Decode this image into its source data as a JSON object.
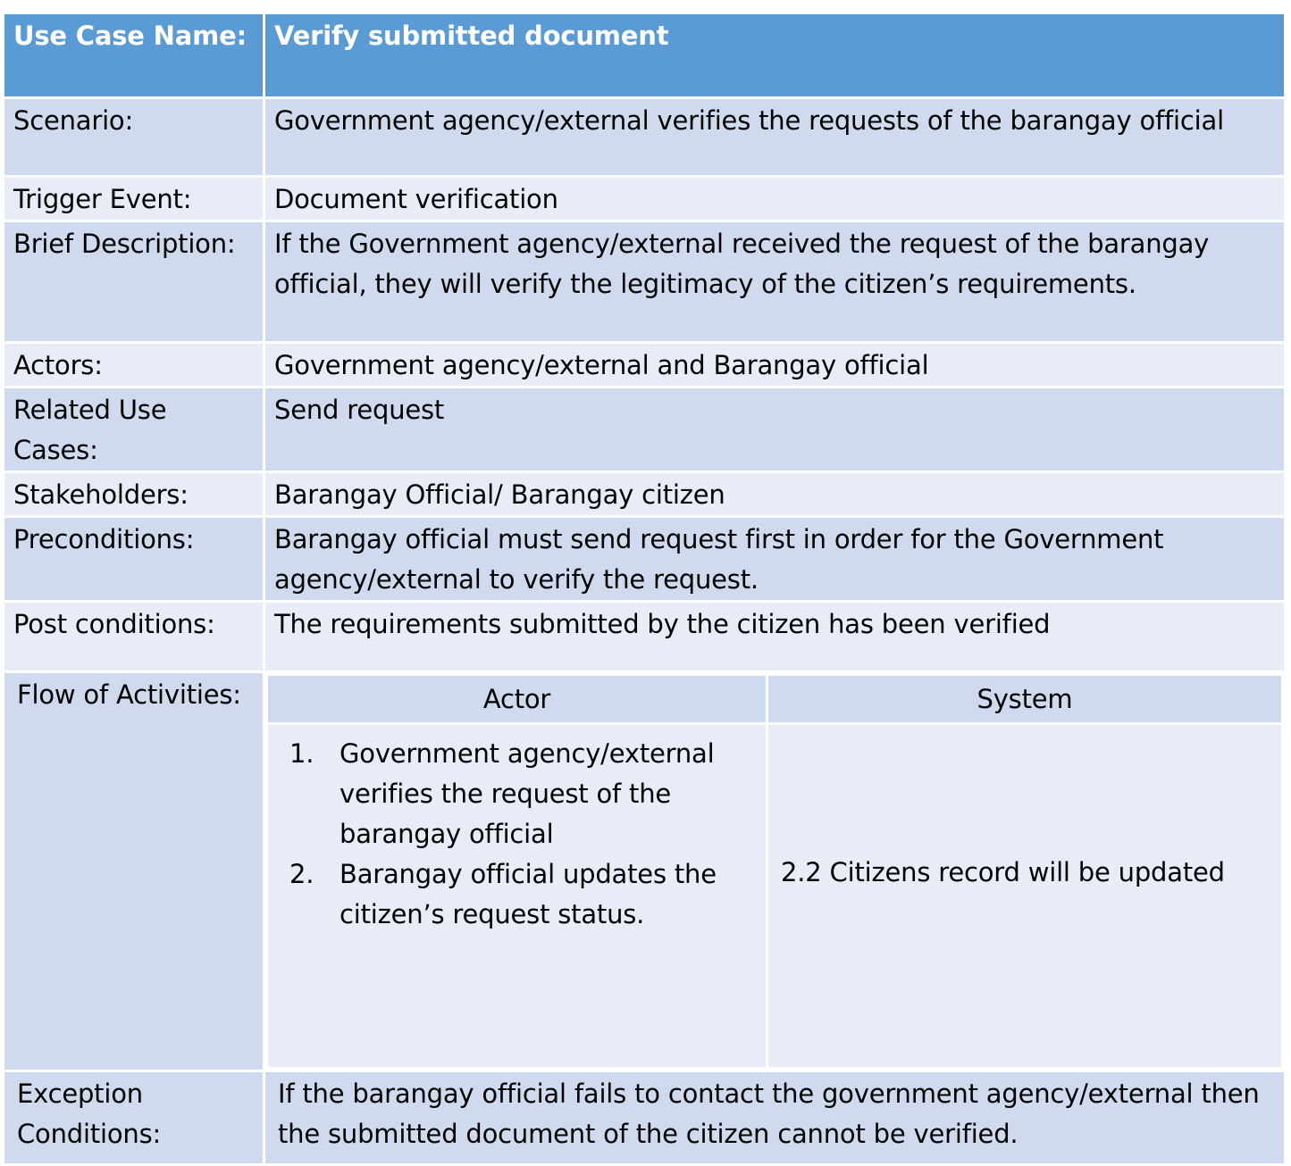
{
  "use_case": {
    "name_label": "Use Case Name:",
    "name_value": "Verify submitted document",
    "rows": [
      {
        "label": "Scenario:",
        "value": "Government agency/external verifies the requests of the barangay official"
      },
      {
        "label": "Trigger Event:",
        "value": "Document verification"
      },
      {
        "label": "Brief Description:",
        "value": "If the Government agency/external received the request of the barangay official, they will verify the legitimacy of the citizen’s requirements."
      },
      {
        "label": "Actors:",
        "value": "Government agency/external and Barangay official"
      },
      {
        "label": "Related Use Cases:",
        "value": "Send request"
      },
      {
        "label": "Stakeholders:",
        "value": "Barangay Official/ Barangay citizen"
      },
      {
        "label": "Preconditions:",
        "value": "Barangay official must send request first in order for the Government agency/external to verify the request."
      },
      {
        "label": "Post conditions:",
        "value": "The requirements submitted by the citizen has been verified"
      }
    ],
    "flow": {
      "label": "Flow of Activities:",
      "actor_header": "Actor",
      "system_header": "System",
      "actor_steps": [
        {
          "num": "1.",
          "text": "Government agency/external verifies  the request of the barangay official"
        },
        {
          "num": "2.",
          "text": "Barangay official updates the citizen’s request status."
        }
      ],
      "system_text": "2.2 Citizens record will be updated"
    },
    "exception": {
      "label": "Exception Conditions:",
      "value": "If the barangay official fails to contact the government agency/external then the submitted document of the citizen cannot be verified."
    }
  },
  "colors": {
    "header": "#5b9bd5",
    "row_dark": "#cfdaee",
    "row_light": "#e8ecf6"
  }
}
